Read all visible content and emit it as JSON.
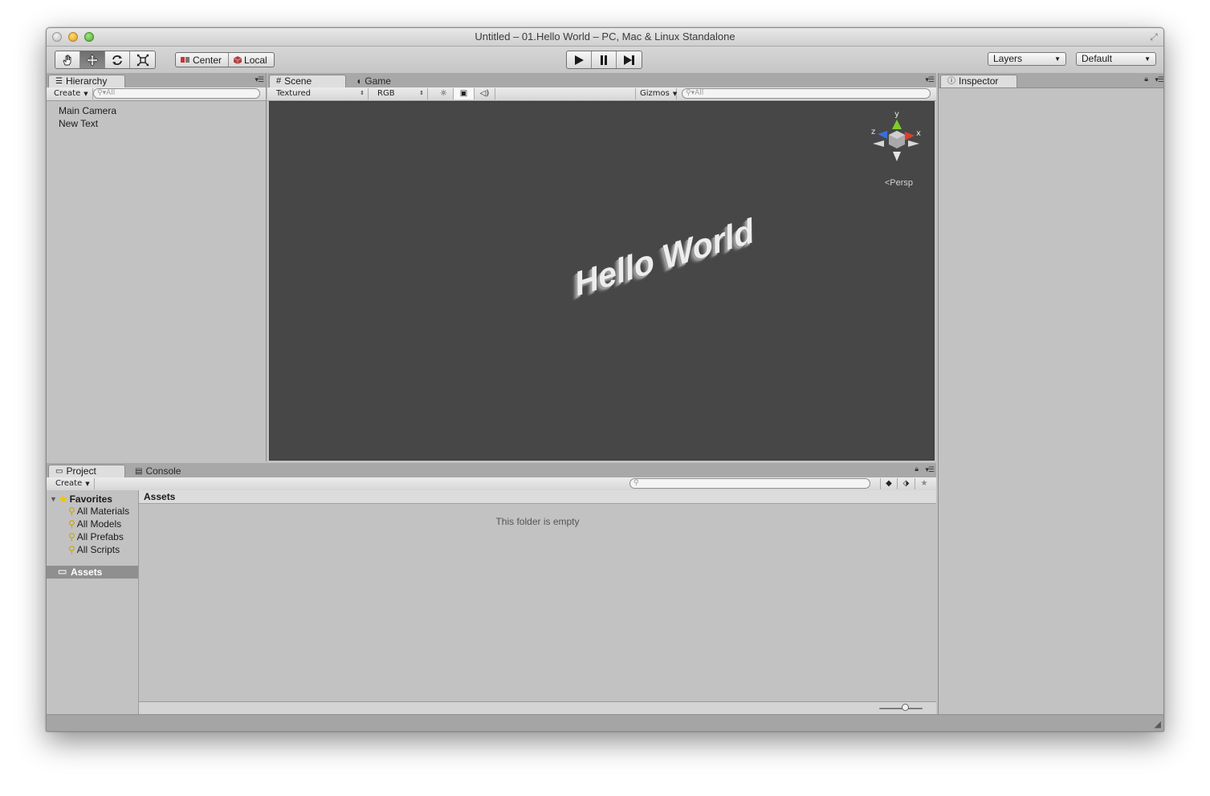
{
  "window": {
    "title": "Untitled – 01.Hello World – PC, Mac & Linux Standalone"
  },
  "toolbar": {
    "transform_tools": [
      "hand-icon",
      "move-icon",
      "rotate-icon",
      "scale-icon"
    ],
    "active_tool": "move-icon",
    "pivot_center": "Center",
    "pivot_local": "Local",
    "play_controls": [
      "play-icon",
      "pause-icon",
      "step-icon"
    ],
    "layers_label": "Layers",
    "layout_label": "Default"
  },
  "hierarchy": {
    "tab": "Hierarchy",
    "create_label": "Create",
    "search_placeholder": "All",
    "items": [
      "Main Camera",
      "New Text"
    ]
  },
  "scene": {
    "tab_scene": "Scene",
    "tab_game": "Game",
    "render_mode": "Textured",
    "color_mode": "RGB",
    "gizmos_label": "Gizmos",
    "search_placeholder": "All",
    "scene_text": "Hello World",
    "persp_label": "Persp",
    "gizmo_axes": {
      "y": "y",
      "x": "x",
      "z": "z"
    },
    "colors": {
      "background": "#474747",
      "axis_x": "#d9402b",
      "axis_y": "#7fcc2a",
      "axis_z": "#3c6fd8"
    }
  },
  "inspector": {
    "tab": "Inspector"
  },
  "project": {
    "tab_project": "Project",
    "tab_console": "Console",
    "create_label": "Create",
    "favorites_label": "Favorites",
    "favorites": [
      "All Materials",
      "All Models",
      "All Prefabs",
      "All Scripts"
    ],
    "assets_folder": "Assets",
    "assets_header": "Assets",
    "empty_message": "This folder is empty"
  }
}
